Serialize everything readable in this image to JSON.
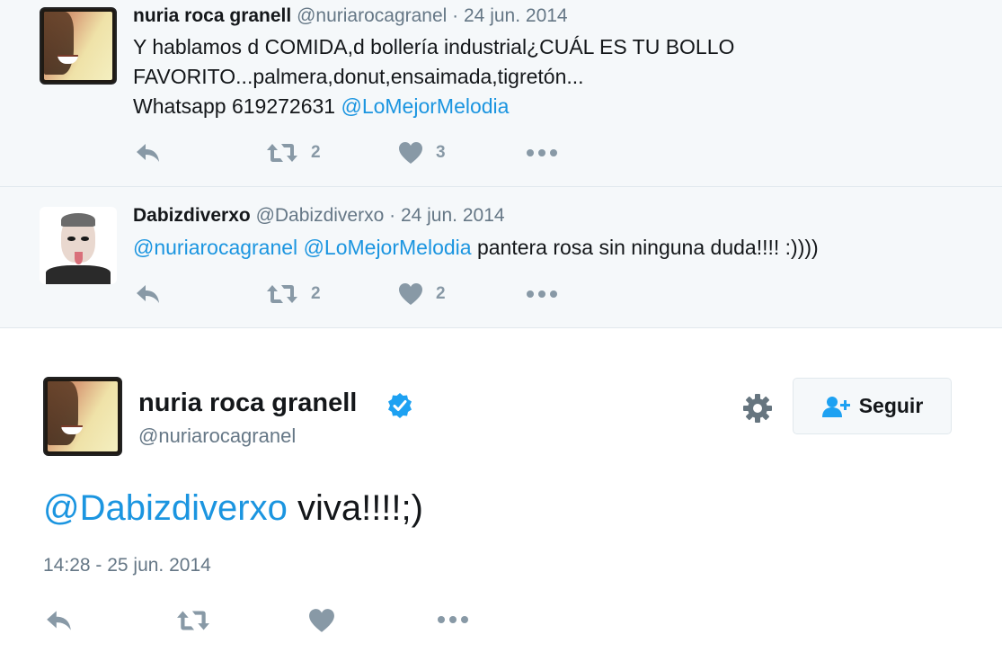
{
  "replies": [
    {
      "name": "nuria roca granell",
      "handle": "@nuriarocagranel",
      "date": "· 24 jun. 2014",
      "line1": "Y hablamos d COMIDA,d bollería industrial¿CUÁL ES TU BOLLO",
      "line2": "FAVORITO...palmera,donut,ensaimada,tigretón...",
      "line3_text": "Whatsapp 619272631 ",
      "line3_mention": "@LoMejorMelodia",
      "retweets": "2",
      "likes": "3"
    },
    {
      "name": "Dabizdiverxo",
      "handle": "@Dabizdiverxo",
      "date": "· 24 jun. 2014",
      "mention1": "@nuriarocagranel",
      "mention2": "@LoMejorMelodia",
      "text": " pantera rosa sin ninguna duda!!!! :))))",
      "retweets": "2",
      "likes": "2"
    }
  ],
  "main": {
    "name": "nuria roca granell",
    "handle": "@nuriarocagranel",
    "mention": "@Dabizdiverxo",
    "text": " viva!!!!;)",
    "timestamp": "14:28 - 25 jun. 2014",
    "follow_label": "Seguir"
  },
  "icons": {
    "reply": "reply-icon",
    "retweet": "retweet-icon",
    "like": "heart-icon",
    "more": "more-icon",
    "verified": "verified-badge-icon",
    "settings": "gear-icon",
    "follow": "add-user-icon"
  },
  "colors": {
    "link": "#1b95e0",
    "action_gray": "#8899a6",
    "meta_gray": "#657786",
    "reply_bg": "#f5f8fa"
  }
}
